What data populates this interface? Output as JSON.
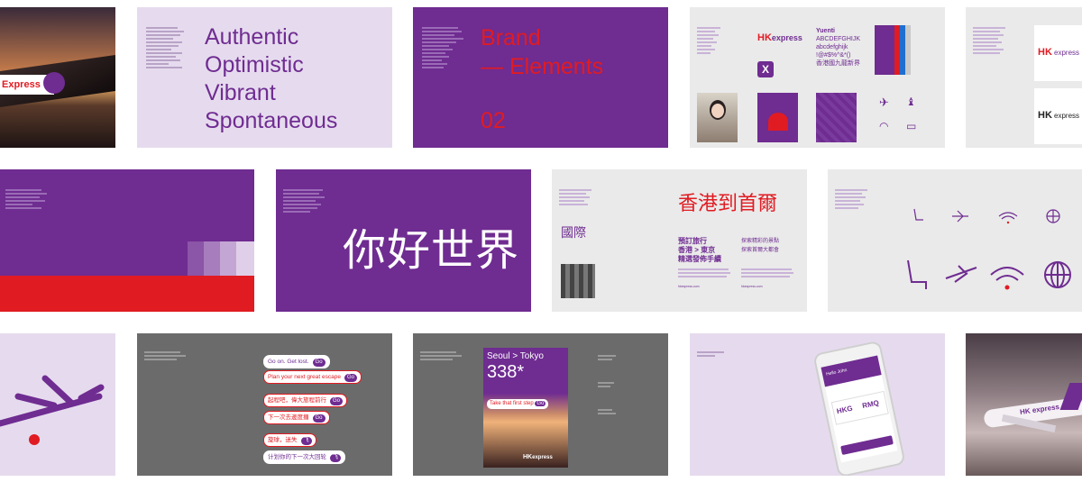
{
  "tile1": {
    "brand_text": "Express"
  },
  "tile2": {
    "values": [
      "Authentic",
      "Optimistic",
      "Vibrant",
      "Spontaneous"
    ]
  },
  "tile3": {
    "title_line1": "Brand",
    "title_line2": "— Elements",
    "number": "02"
  },
  "tile4": {
    "logo_hk": "HK",
    "logo_express": "express",
    "font_name": "Yuenti",
    "alphabet_upper": "ABCDEFGHIJK",
    "alphabet_lower": "abcdefghijk",
    "symbols": "!@#$%^&*()",
    "cjk_sample": "香港國九龍新界"
  },
  "tile5": {
    "logo_hk": "HK",
    "logo_express": "express"
  },
  "tile8": {
    "headline": "你好世界"
  },
  "tile9": {
    "headline": "香港到首爾",
    "word": "國際",
    "line1": "預訂旅行",
    "line2": "香港 > 東京",
    "line3": "精選發佈手續",
    "line4": "探索精彩的景點",
    "line5": "探索首爾大都會",
    "url1": "hkexpress.com",
    "url2": "hkexpress.com"
  },
  "tile12": {
    "pills": [
      {
        "text": "Go on. Get lost.",
        "go": "Go"
      },
      {
        "text": "Plan your next great escape",
        "go": "Go"
      },
      {
        "text": "起程吧，偉大旅程前行",
        "go": "Go"
      },
      {
        "text": "下一次去邊度攞",
        "go": "Go"
      },
      {
        "text": "旋球，迷失",
        "go": "飞"
      },
      {
        "text": "计划你的下一次大回轮",
        "go": "飞"
      }
    ]
  },
  "tile13": {
    "route": "Seoul > Tokyo",
    "price": "338*",
    "cta": "Take that first step",
    "go": "Go",
    "logo_hk": "HK",
    "logo_express": "express"
  },
  "tile14": {
    "app_title": "Hello John",
    "from": "HKG",
    "to": "RMQ"
  },
  "tile15": {
    "plane_text": "HK express"
  }
}
